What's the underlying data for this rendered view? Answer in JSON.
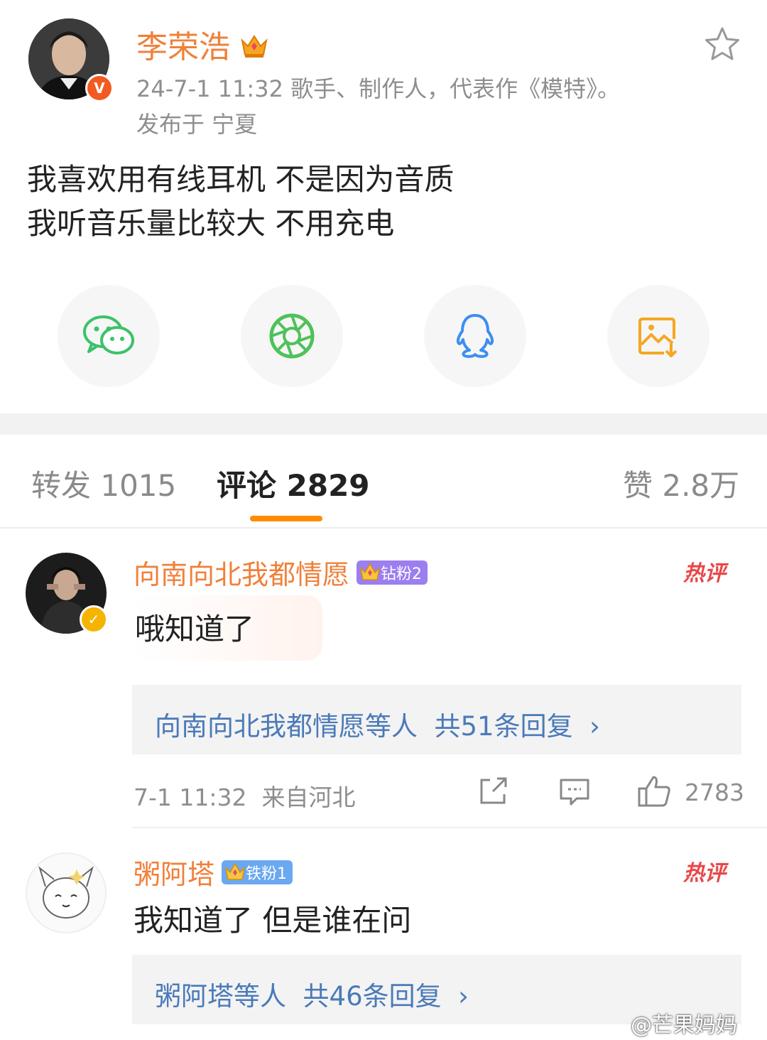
{
  "post": {
    "author": "李荣浩",
    "meta": "24-7-1 11:32  歌手、制作人，代表作《模特》。",
    "location": "发布于 宁夏",
    "lines": [
      "我喜欢用有线耳机 不是因为音质",
      "我听音乐量比较大 不用充电"
    ],
    "verified_badge": "V"
  },
  "share_icons": [
    "wechat-icon",
    "moments-icon",
    "qq-icon",
    "save-image-icon"
  ],
  "tabs": {
    "repost": "转发 1015",
    "comments": "评论 2829",
    "likes": "赞 2.8万"
  },
  "comments": [
    {
      "name": "向南向北我都情愿",
      "badge": "钻粉2",
      "badge_color": "#9b7ef0",
      "hot": "热评",
      "text": "哦知道了",
      "replies": "向南向北我都情愿等人  共51条回复  ›",
      "time": "7-1 11:32  来自河北",
      "likes": "2783"
    },
    {
      "name": "粥阿塔",
      "badge": "铁粉1",
      "badge_color": "#6aa8f0",
      "hot": "热评",
      "text": "我知道了 但是谁在问",
      "replies": "粥阿塔等人  共46条回复  ›"
    }
  ],
  "watermark": "@芒果妈妈",
  "colors": {
    "accent": "#f0803a",
    "tab_underline": "#ff8c00",
    "link": "#4a7ab8",
    "hot": "#e8484a"
  }
}
